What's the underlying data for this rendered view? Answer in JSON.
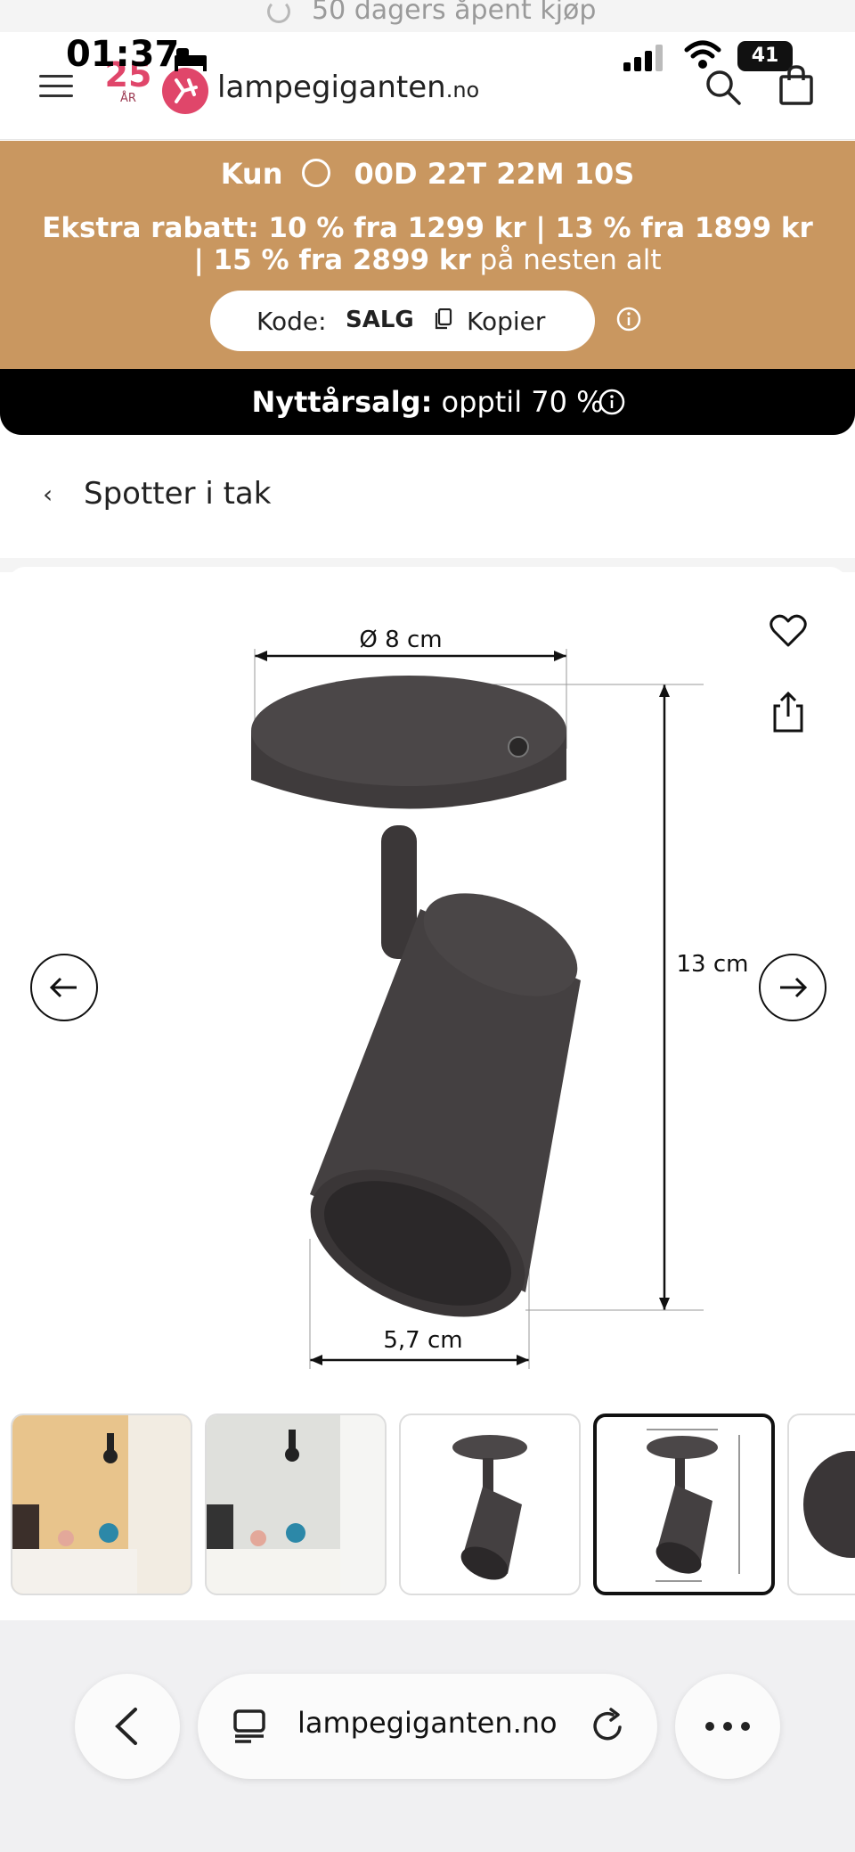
{
  "top_strip": {
    "text": "50 dagers åpent kjøp"
  },
  "status_bar": {
    "time": "01:37",
    "battery": "41"
  },
  "header": {
    "badge_number": "25",
    "badge_sub": "ÅR",
    "logo_name": "lampegiganten",
    "logo_tld": ".no"
  },
  "promo": {
    "kun_label": "Kun",
    "countdown": "00D 22T 22M 10S",
    "discount_bold": "Ekstra rabatt: 10 % fra 1299 kr | 13 % fra 1899 kr | 15 % fra 2899 kr",
    "discount_rest": " på nesten alt",
    "code_label": "Kode:",
    "code_value": "SALG",
    "copy_label": "Kopier"
  },
  "sale_bar": {
    "bold": "Nyttårsalg:",
    "rest": " opptil 70 %"
  },
  "breadcrumb": {
    "label": "Spotter i tak"
  },
  "product_image": {
    "dim_diameter": "Ø 8 cm",
    "dim_height": "13 cm",
    "dim_opening": "5,7 cm"
  },
  "thumbnails": {
    "count_visible": 5,
    "active_index": 3
  },
  "browser": {
    "url": "lampegiganten.no"
  },
  "colors": {
    "promo_bg": "#c99760",
    "brand_pink": "#e0466a",
    "sale_bg": "#000000"
  },
  "icons": [
    "menu-icon",
    "search-icon",
    "bag-icon",
    "timer-icon",
    "copy-icon",
    "info-icon",
    "chevron-left-icon",
    "heart-icon",
    "share-icon",
    "arrow-left-icon",
    "arrow-right-icon",
    "tabs-icon",
    "reload-icon",
    "more-icon"
  ]
}
